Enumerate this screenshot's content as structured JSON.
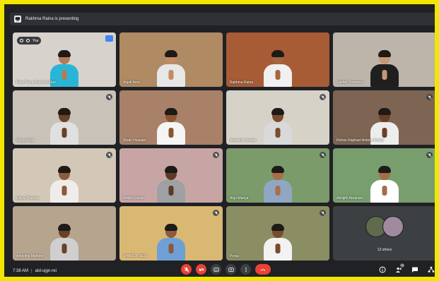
{
  "presentation": {
    "text": "Rakhma Raina is presenting"
  },
  "self_tile": {
    "you_label": "You"
  },
  "participants": [
    {
      "name": "Fairy Tincy (Kakani) Ebel",
      "self": true,
      "muted": false,
      "bg": "#d7d2cc",
      "shirt": "#29b6d6",
      "skin": "#b47a57"
    },
    {
      "name": "Anjali Aron",
      "self": false,
      "muted": false,
      "bg": "#b08a63",
      "shirt": "#e7e7e7",
      "skin": "#c48a63"
    },
    {
      "name": "Rakhma Raina",
      "self": false,
      "muted": false,
      "bg": "#a75c36",
      "shirt": "#f0f0f0",
      "skin": "#a5673f"
    },
    {
      "name": "Sachin Oommen",
      "self": false,
      "muted": false,
      "bg": "#bdb4aa",
      "shirt": "#1f1f1f",
      "skin": "#c79775"
    },
    {
      "name": "Sanya Soju",
      "self": false,
      "muted": true,
      "bg": "#c9c2b8",
      "shirt": "#e0e0e0",
      "skin": "#6a4129"
    },
    {
      "name": "Shalu Hussain",
      "self": false,
      "muted": false,
      "bg": "#a88168",
      "shirt": "#f5f5f5",
      "skin": "#8a5533"
    },
    {
      "name": "Aneesha Joseph",
      "self": false,
      "muted": true,
      "bg": "#d6d2c8",
      "shirt": "#d9d9d9",
      "skin": "#7a4c2f"
    },
    {
      "name": "Rohan Raphael Antony Koshy",
      "self": false,
      "muted": true,
      "bg": "#7e6452",
      "shirt": "#ededed",
      "skin": "#6b4027"
    },
    {
      "name": "Divya Thomas",
      "self": false,
      "muted": true,
      "bg": "#d3c7b7",
      "shirt": "#f0ecea",
      "skin": "#8c5a3c"
    },
    {
      "name": "Ambili Kishor",
      "self": false,
      "muted": true,
      "bg": "#c8a5a5",
      "shirt": "#9ea0a3",
      "skin": "#5d3a25"
    },
    {
      "name": "Anju Mariya",
      "self": false,
      "muted": true,
      "bg": "#7b9b6a",
      "shirt": "#8fa7c3",
      "skin": "#a86e48"
    },
    {
      "name": "Abhijith Abraham",
      "self": false,
      "muted": true,
      "bg": "#789e6e",
      "shirt": "#ffffff",
      "skin": "#a36d49"
    },
    {
      "name": "Angeline Mathew",
      "self": false,
      "muted": false,
      "bg": "#b7a48f",
      "shirt": "#cfcfcf",
      "skin": "#6b4026"
    },
    {
      "name": "SHARON SEDI",
      "self": false,
      "muted": true,
      "bg": "#d9b873",
      "shirt": "#6fa0d5",
      "skin": "#8d5a3a"
    },
    {
      "name": "Pooja",
      "self": false,
      "muted": true,
      "bg": "#8b8e62",
      "shirt": "#f2f2f2",
      "skin": "#7a4a2e"
    }
  ],
  "others_tile": {
    "label": "13 others"
  },
  "meeting": {
    "time": "7:38 AM",
    "separator": "|",
    "code": "atd-ujgn-rei"
  },
  "colors": {
    "accent": "#8ab4f8",
    "danger": "#ea4335",
    "background": "#202124",
    "border": "#f2e600"
  },
  "icons": [
    "presentation-icon",
    "mic-off-icon",
    "cam-off-icon",
    "captions-icon",
    "present-icon",
    "more-icon",
    "hangup-icon",
    "info-icon",
    "people-icon",
    "chat-icon",
    "activities-icon"
  ],
  "participant_count_badge": "18"
}
